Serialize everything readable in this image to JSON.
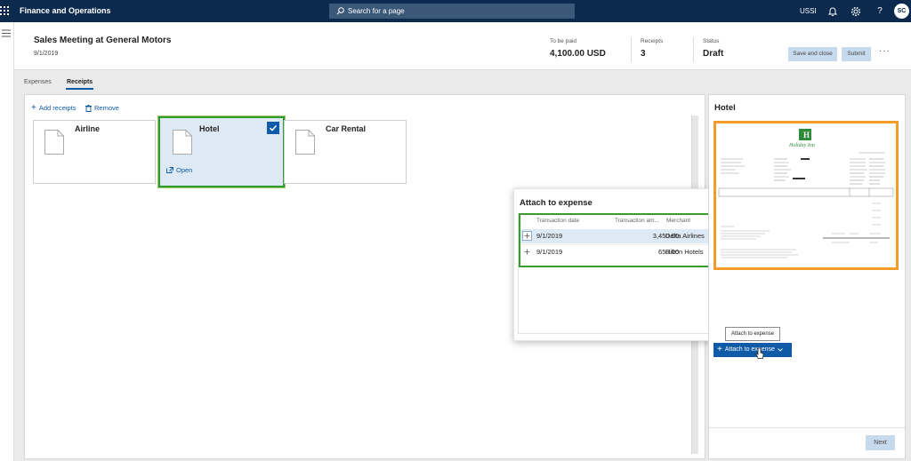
{
  "topbar": {
    "app_title": "Finance and Operations",
    "search_placeholder": "Search for a page",
    "company": "USSI",
    "user_initials": "SC"
  },
  "header": {
    "title": "Sales Meeting at General Motors",
    "date": "9/1/2019",
    "to_be_paid_label": "To be paid",
    "to_be_paid_value": "4,100.00 USD",
    "receipts_label": "Receipts",
    "receipts_value": "3",
    "status_label": "Status",
    "status_value": "Draft",
    "save_close_label": "Save and close",
    "submit_label": "Submit",
    "more_label": "···"
  },
  "tabs": [
    {
      "label": "Expenses"
    },
    {
      "label": "Receipts",
      "selected": true
    }
  ],
  "toolbar": {
    "add_label": "Add receipts",
    "remove_label": "Remove"
  },
  "receipts": [
    {
      "name": "Airline"
    },
    {
      "name": "Hotel",
      "selected": true,
      "open_label": "Open"
    },
    {
      "name": "Car Rental"
    }
  ],
  "attach": {
    "title": "Attach to expense",
    "columns": [
      "Transaction date",
      "Transaction am...",
      "Merchant"
    ],
    "rows": [
      {
        "date": "9/1/2019",
        "amount": "3,450.00",
        "merchant": "Delta Airlines"
      },
      {
        "date": "9/1/2019",
        "amount": "650.00",
        "merchant": "Hilton Hotels"
      }
    ]
  },
  "preview": {
    "title": "Hotel",
    "tooltip": "Attach to expense",
    "attach_button_label": "Attach to expense",
    "next_label": "Next",
    "receipt_brand": "Holiday Inn"
  },
  "colors": {
    "nav": "#0c2a4d",
    "accent": "#0f5ba7",
    "highlight_green": "#2f9b2f",
    "highlight_orange": "#f39c2a"
  }
}
